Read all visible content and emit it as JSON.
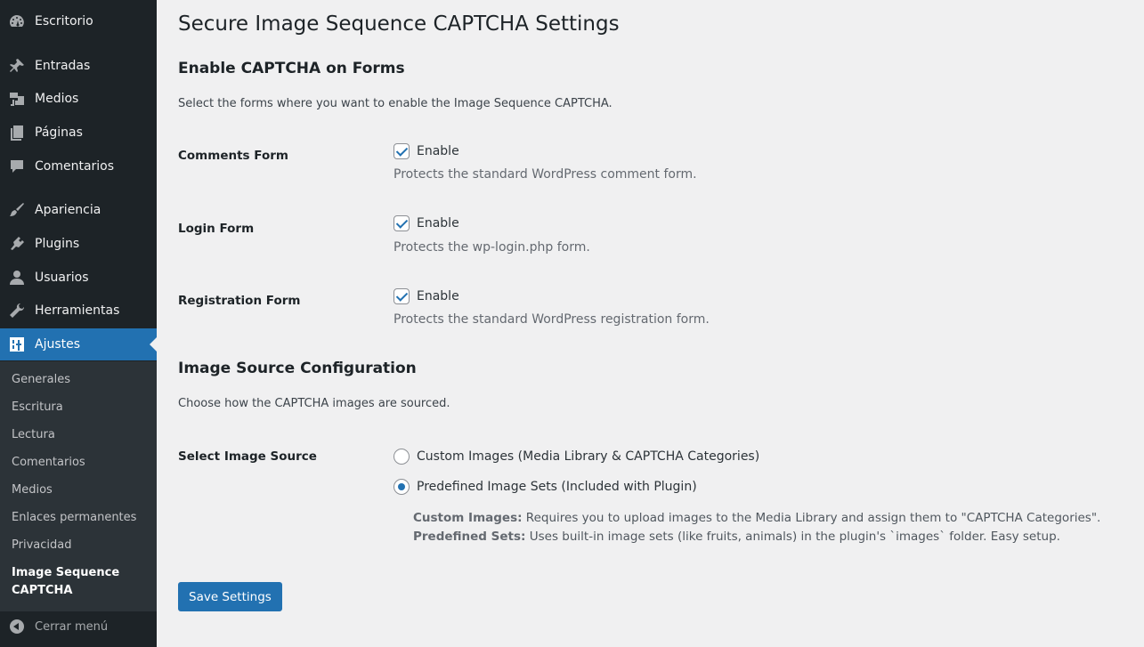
{
  "sidebar": {
    "menu": [
      {
        "label": "Escritorio",
        "icon": "dashboard-icon"
      },
      {
        "label": "Entradas",
        "icon": "pin-icon"
      },
      {
        "label": "Medios",
        "icon": "media-icon"
      },
      {
        "label": "Páginas",
        "icon": "pages-icon"
      },
      {
        "label": "Comentarios",
        "icon": "comments-icon"
      },
      {
        "label": "Apariencia",
        "icon": "brush-icon"
      },
      {
        "label": "Plugins",
        "icon": "plugin-icon"
      },
      {
        "label": "Usuarios",
        "icon": "user-icon"
      },
      {
        "label": "Herramientas",
        "icon": "wrench-icon"
      },
      {
        "label": "Ajustes",
        "icon": "settings-icon"
      }
    ],
    "submenu": [
      "Generales",
      "Escritura",
      "Lectura",
      "Comentarios",
      "Medios",
      "Enlaces permanentes",
      "Privacidad",
      "Image Sequence CAPTCHA"
    ],
    "collapse_label": "Cerrar menú",
    "accent_color": "#2271b1"
  },
  "page": {
    "title": "Secure Image Sequence CAPTCHA Settings",
    "section1": {
      "title": "Enable CAPTCHA on Forms",
      "description": "Select the forms where you want to enable the Image Sequence CAPTCHA.",
      "rows": [
        {
          "label": "Comments Form",
          "checkbox_label": "Enable",
          "checked": true,
          "help": "Protects the standard WordPress comment form."
        },
        {
          "label": "Login Form",
          "checkbox_label": "Enable",
          "checked": true,
          "help": "Protects the wp-login.php form."
        },
        {
          "label": "Registration Form",
          "checkbox_label": "Enable",
          "checked": true,
          "help": "Protects the standard WordPress registration form."
        }
      ]
    },
    "section2": {
      "title": "Image Source Configuration",
      "description": "Choose how the CAPTCHA images are sourced.",
      "row_label": "Select Image Source",
      "options": [
        {
          "label": "Custom Images (Media Library & CAPTCHA Categories)",
          "checked": false
        },
        {
          "label": "Predefined Image Sets (Included with Plugin)",
          "checked": true
        }
      ],
      "note_custom_title": "Custom Images:",
      "note_custom_text": " Requires you to upload images to the Media Library and assign them to \"CAPTCHA Categories\".",
      "note_predef_title": "Predefined Sets:",
      "note_predef_text": " Uses built-in image sets (like fruits, animals) in the plugin's `images` folder. Easy setup."
    },
    "save_label": "Save Settings"
  }
}
